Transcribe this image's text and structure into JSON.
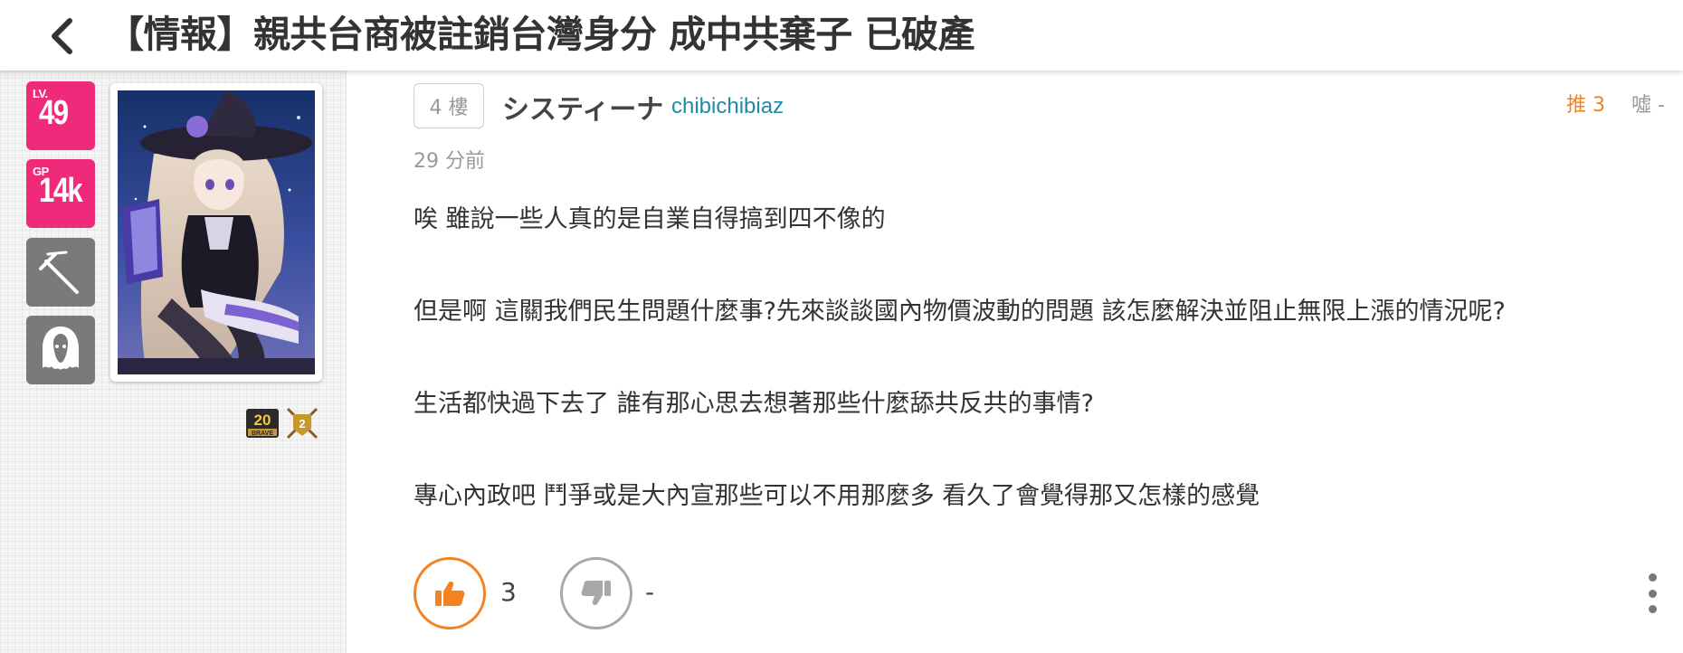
{
  "header": {
    "title": "【情報】親共台商被註銷台灣身分 成中共棄子 已破產",
    "back_icon": "chevron-left-icon"
  },
  "author_panel": {
    "level": {
      "label": "LV.",
      "value": "49"
    },
    "gp": {
      "label": "GP",
      "value": "14k"
    },
    "role_icons": [
      "sword-icon",
      "ghost-icon"
    ],
    "medals": [
      "20-brave-medal-icon",
      "20-anniversary-medal-icon"
    ]
  },
  "post": {
    "floor": "4 樓",
    "author_name": "システィーナ",
    "author_id": "chibichibiaz",
    "time": "29 分前",
    "push_label": "推 3",
    "boo_label": "噓 -",
    "paragraphs": [
      "唉 雖說一些人真的是自業自得搞到四不像的",
      "但是啊 這關我們民生問題什麼事?先來談談國內物價波動的問題 該怎麼解決並阻止無限上漲的情況呢?",
      "生活都快過下去了 誰有那心思去想著那些什麼舔共反共的事情?",
      "專心內政吧 鬥爭或是大內宣那些可以不用那麼多 看久了會覺得那又怎樣的感覺"
    ],
    "like_count": "3",
    "dislike_count": "-"
  },
  "colors": {
    "accent_pink": "#f02a7a",
    "accent_orange": "#f58220",
    "link_teal": "#1e8ca8"
  }
}
